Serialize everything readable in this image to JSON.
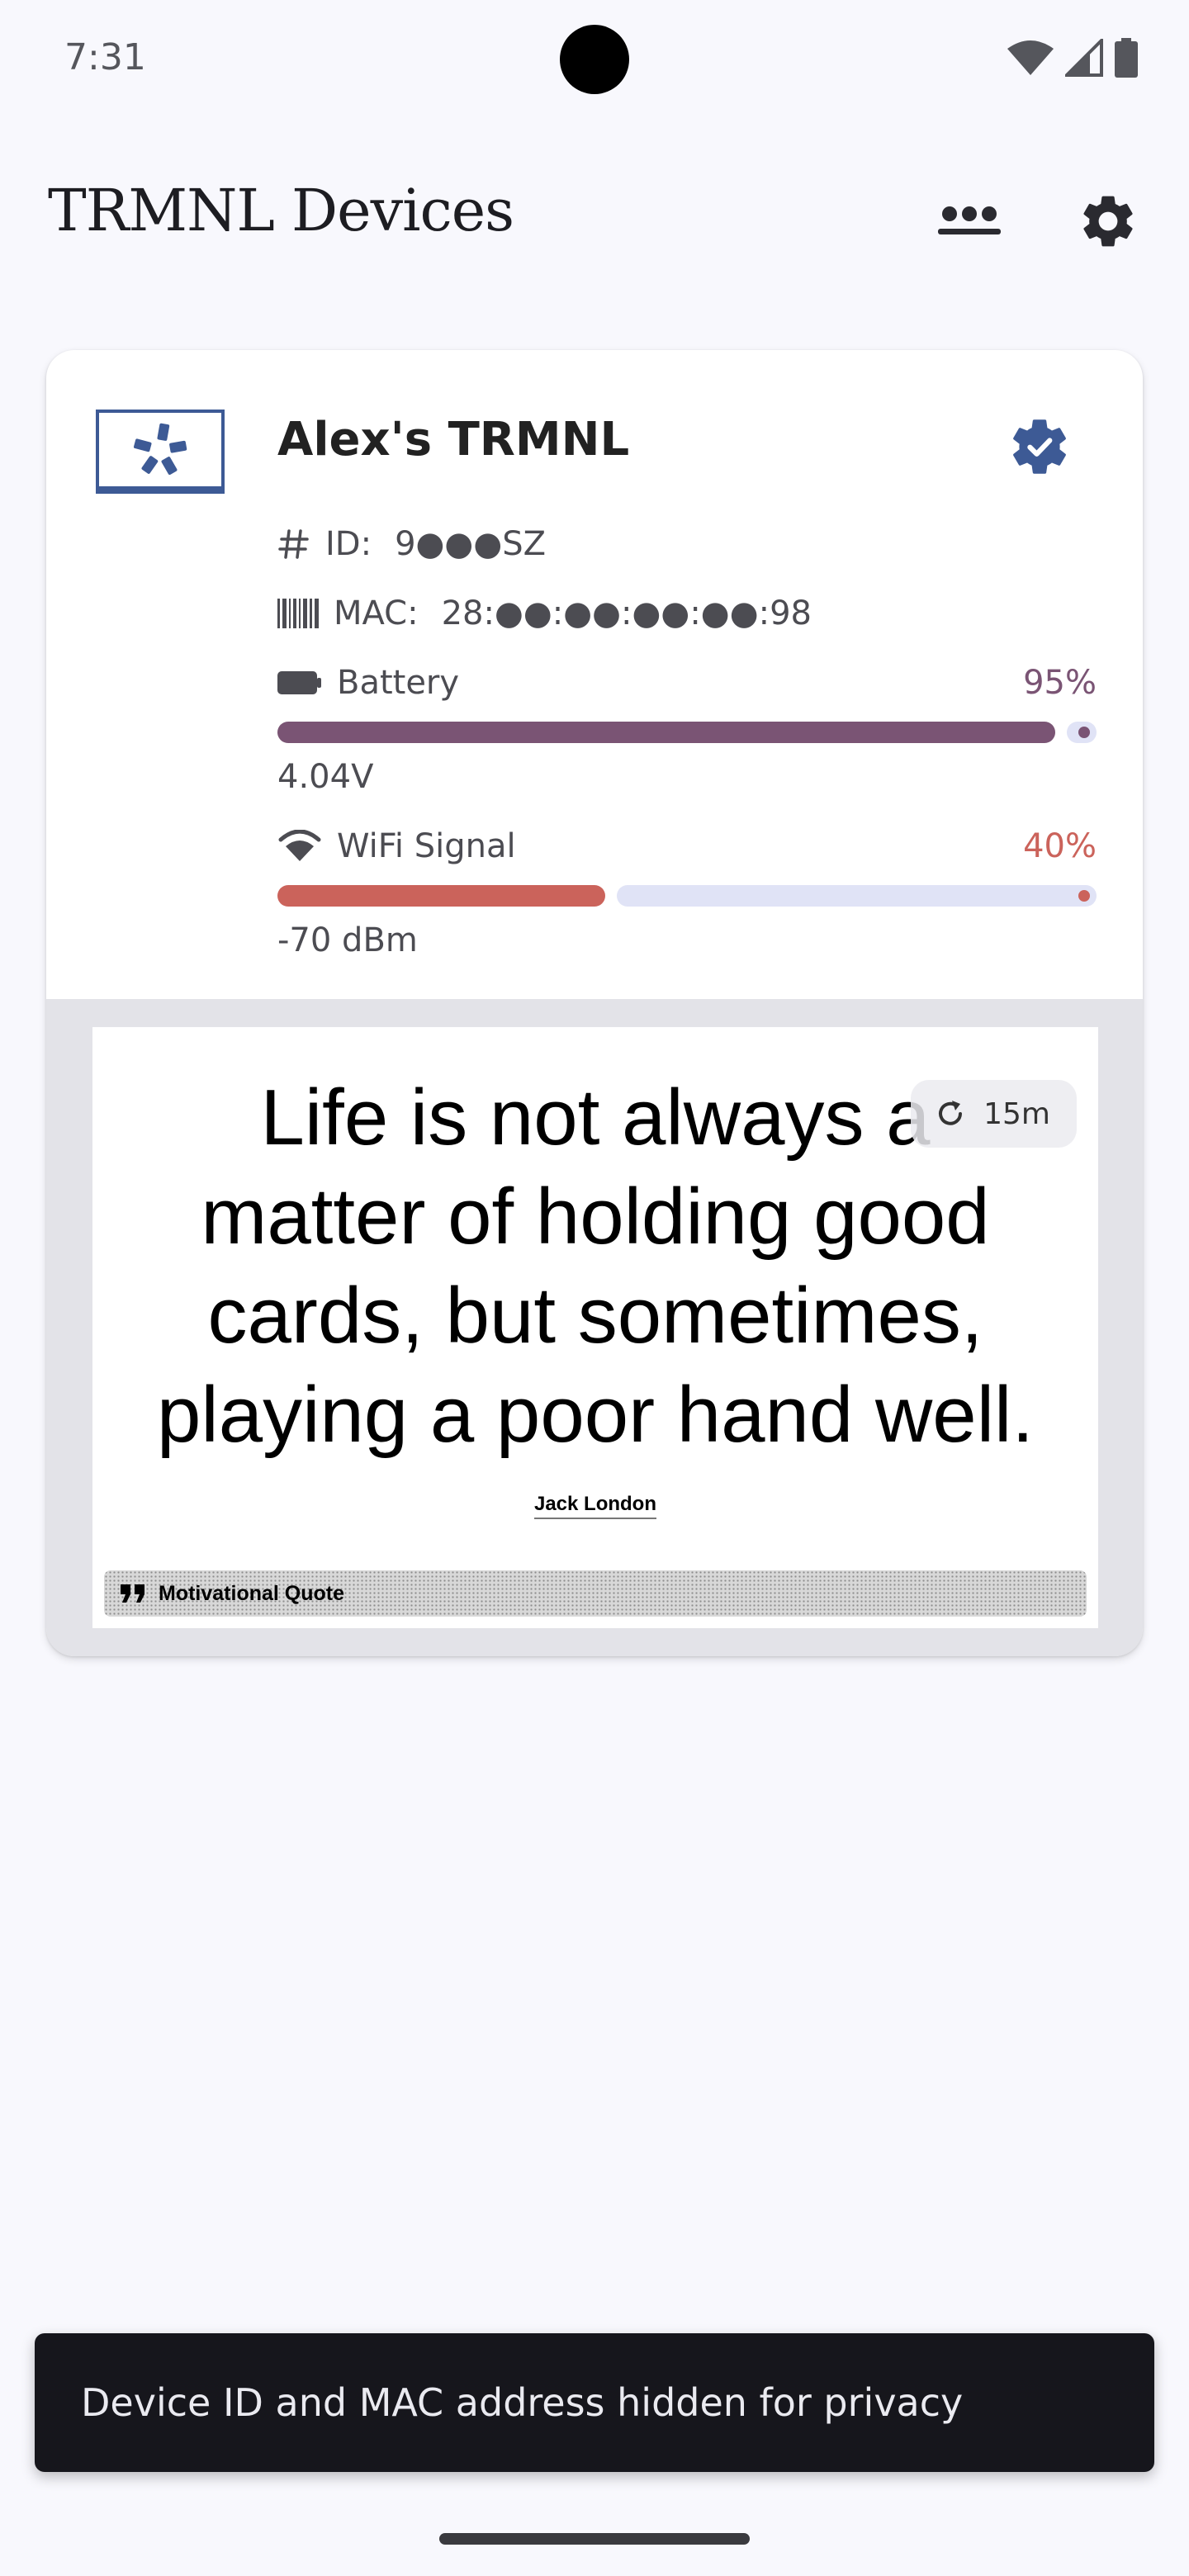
{
  "status_bar": {
    "time": "7:31",
    "icons": [
      "wifi-icon",
      "cell-signal-icon",
      "battery-icon"
    ]
  },
  "app_bar": {
    "title": "TRMNL Devices",
    "actions": [
      "dots-more-icon",
      "gear-icon"
    ]
  },
  "device": {
    "name": "Alex's TRMNL",
    "status_icon": "verified-gear-icon",
    "id_label": "ID:",
    "id_value": "9●●●SZ",
    "mac_label": "MAC:",
    "mac_value": "28:●●:●●:●●:●●:98",
    "battery": {
      "label": "Battery",
      "percent_text": "95%",
      "level": 0.95,
      "voltage": "4.04V",
      "color": "#7a5474"
    },
    "wifi": {
      "label": "WiFi Signal",
      "percent_text": "40%",
      "level": 0.4,
      "dbm": "-70 dBm",
      "color": "#cb635b",
      "track_color": "#e0e3f6"
    }
  },
  "preview": {
    "quote_lines": [
      "Life is not always a",
      "matter of holding good",
      "cards, but sometimes,",
      "playing a poor hand well."
    ],
    "author": "Jack London",
    "refresh_interval": "15m",
    "plugin_name": "Motivational Quote"
  },
  "snackbar": {
    "message": "Device ID and MAC address hidden for privacy"
  },
  "colors": {
    "background": "#f8f8fd",
    "accent_blue": "#3d5a95",
    "battery_purple": "#7a5474",
    "wifi_red": "#cb635b"
  }
}
